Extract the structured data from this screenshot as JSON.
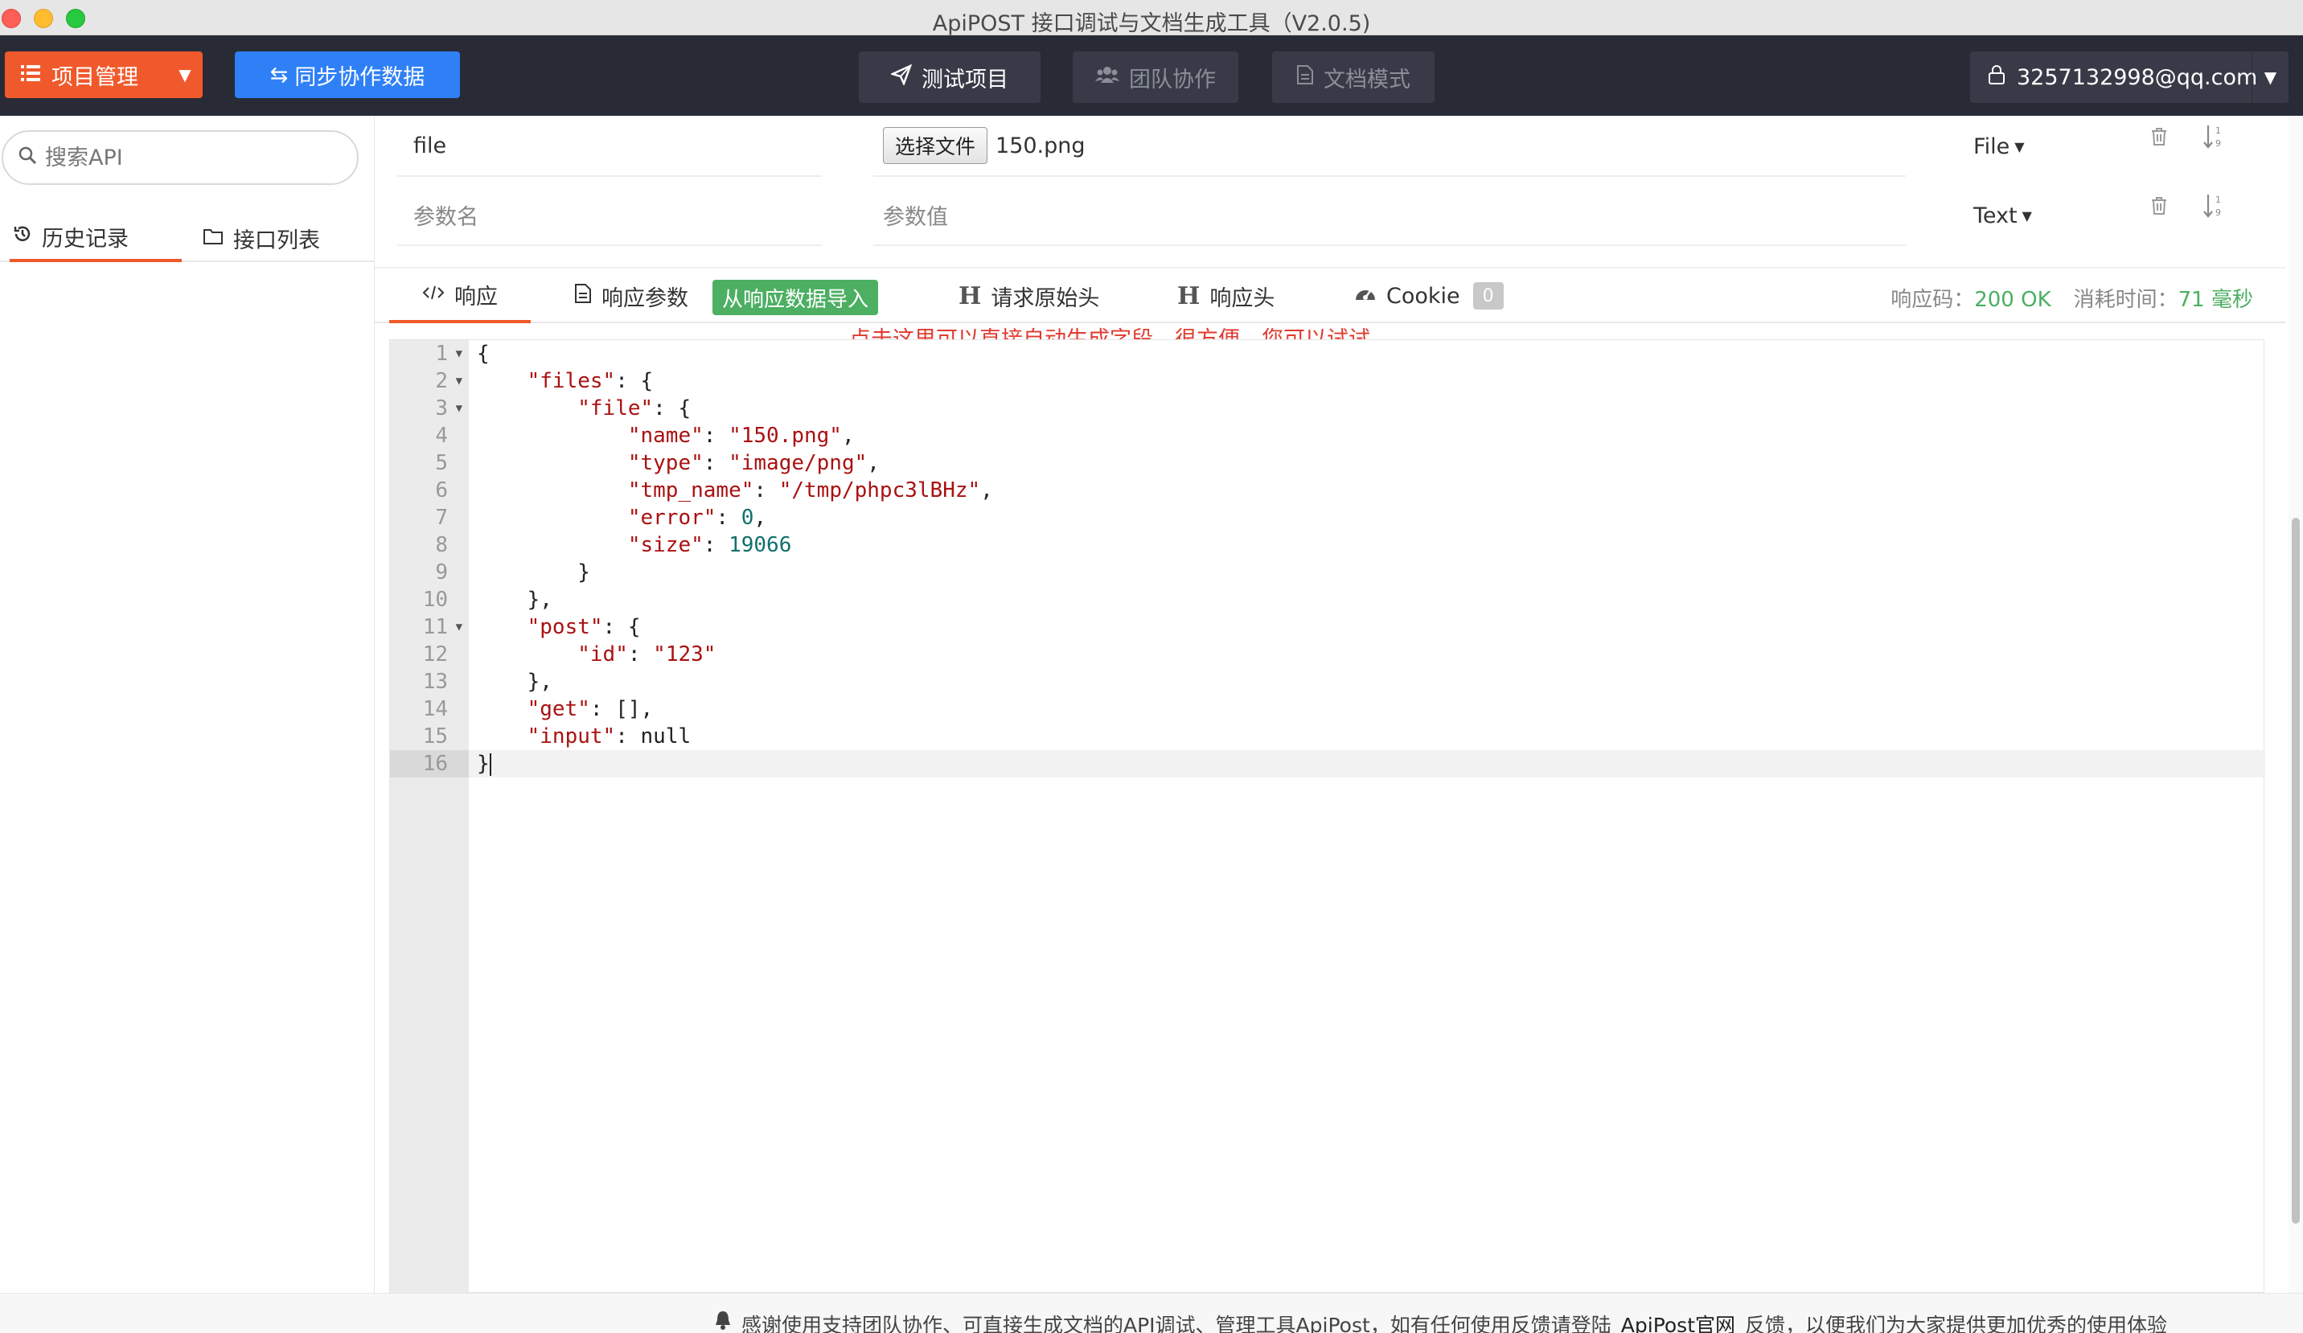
{
  "window": {
    "title": "ApiPOST 接口调试与文档生成工具（V2.0.5)"
  },
  "topnav": {
    "project_label": "项目管理",
    "sync_label": "同步协作数据",
    "tabs": [
      {
        "label": "测试项目",
        "icon": "paper-plane-icon"
      },
      {
        "label": "团队协作",
        "icon": "users-icon"
      },
      {
        "label": "文档模式",
        "icon": "document-icon"
      }
    ],
    "user_email": "3257132998@qq.com"
  },
  "sidebar": {
    "search_placeholder": "搜索API",
    "tabs": [
      {
        "label": "历史记录",
        "icon": "history-icon"
      },
      {
        "label": "接口列表",
        "icon": "folder-icon"
      }
    ]
  },
  "params": {
    "rows": [
      {
        "name": "file",
        "file_button": "选择文件",
        "value": "150.png",
        "type": "File"
      },
      {
        "name_placeholder": "参数名",
        "value_placeholder": "参数值",
        "type": "Text"
      }
    ]
  },
  "response": {
    "tabs": [
      {
        "label": "响应",
        "icon": "code-icon"
      },
      {
        "label": "响应参数",
        "icon": "file-text-icon"
      },
      {
        "label": "请求原始头"
      },
      {
        "label": "响应头"
      },
      {
        "label": "Cookie",
        "badge": "0"
      }
    ],
    "import_button": "从响应数据导入",
    "status_label": "响应码：",
    "status_value": "200 OK",
    "time_label": "消耗时间：",
    "time_value": "71 毫秒",
    "hint": "点击这里可以直接自动生成字段，很方便，您可以试试"
  },
  "editor": {
    "line_numbers": [
      "1",
      "2",
      "3",
      "4",
      "5",
      "6",
      "7",
      "8",
      "9",
      "10",
      "11",
      "12",
      "13",
      "14",
      "15",
      "16"
    ],
    "tokens": {
      "files_key": "\"files\"",
      "file_key": "\"file\"",
      "name_key": "\"name\"",
      "name_val": "\"150.png\"",
      "type_key": "\"type\"",
      "type_val": "\"image/png\"",
      "tmp_key": "\"tmp_name\"",
      "tmp_val": "\"/tmp/phpc3lBHz\"",
      "error_key": "\"error\"",
      "error_val": "0",
      "size_key": "\"size\"",
      "size_val": "19066",
      "post_key": "\"post\"",
      "id_key": "\"id\"",
      "id_val": "\"123\"",
      "get_key": "\"get\"",
      "get_val": "[]",
      "input_key": "\"input\"",
      "input_val": "null"
    }
  },
  "footer": {
    "text": "感谢使用支持团队协作、可直接生成文档的API调试、管理工具ApiPost，如有任何使用反馈请登陆",
    "link": "ApiPost官网",
    "text2": "反馈，以便我们为大家提供更加优秀的使用体验"
  },
  "colors": {
    "accent_orange": "#f0592b",
    "sync_blue": "#2f80f6",
    "nav_bg": "#282b36",
    "success_green": "#4caf62",
    "hint_red": "#e03a2f"
  }
}
